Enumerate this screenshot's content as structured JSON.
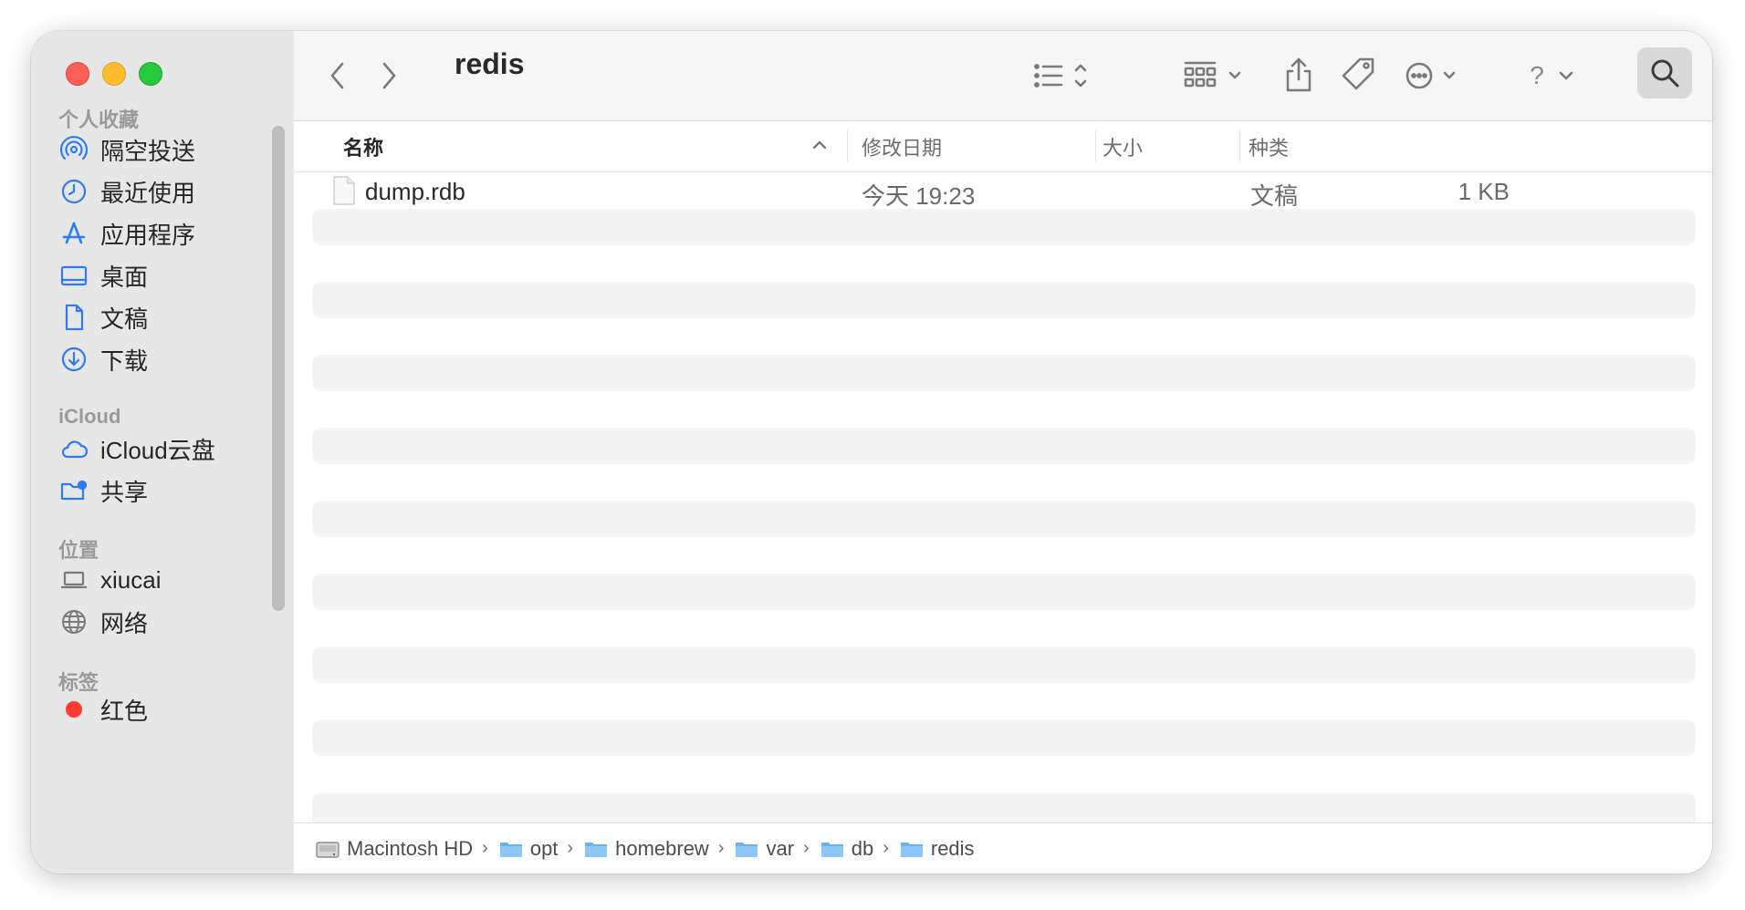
{
  "window": {
    "title": "redis"
  },
  "sidebar": {
    "favorites_header": "个人收藏",
    "favorites": [
      {
        "label": "隔空投送",
        "icon": "airdrop-icon"
      },
      {
        "label": "最近使用",
        "icon": "clock-icon"
      },
      {
        "label": "应用程序",
        "icon": "applications-icon"
      },
      {
        "label": "桌面",
        "icon": "desktop-icon"
      },
      {
        "label": "文稿",
        "icon": "document-icon"
      },
      {
        "label": "下载",
        "icon": "download-icon"
      }
    ],
    "icloud_header": "iCloud",
    "icloud": [
      {
        "label": "iCloud云盘",
        "icon": "cloud-icon"
      },
      {
        "label": "共享",
        "icon": "shared-folder-icon"
      }
    ],
    "locations_header": "位置",
    "locations": [
      {
        "label": "xiucai",
        "icon": "laptop-icon"
      },
      {
        "label": "网络",
        "icon": "globe-icon"
      }
    ],
    "tags_header": "标签",
    "tags": [
      {
        "label": "红色",
        "color": "#fe3b30"
      }
    ]
  },
  "toolbar": {
    "back": "chevron-left-icon",
    "forward": "chevron-right-icon",
    "view": "list-view-icon",
    "group": "group-icon",
    "share": "share-icon",
    "tag": "tag-icon",
    "more": "ellipsis-icon",
    "help": "?",
    "search": "search-icon"
  },
  "columns": {
    "name": "名称",
    "modified": "修改日期",
    "size": "大小",
    "kind": "种类"
  },
  "files": [
    {
      "name": "dump.rdb",
      "modified": "今天 19:23",
      "size": "1 KB",
      "kind": "文稿"
    }
  ],
  "pathbar": [
    {
      "label": "Macintosh HD",
      "icon": "drive-icon"
    },
    {
      "label": "opt",
      "icon": "folder-icon"
    },
    {
      "label": "homebrew",
      "icon": "folder-icon"
    },
    {
      "label": "var",
      "icon": "folder-icon"
    },
    {
      "label": "db",
      "icon": "folder-icon"
    },
    {
      "label": "redis",
      "icon": "folder-icon"
    }
  ]
}
